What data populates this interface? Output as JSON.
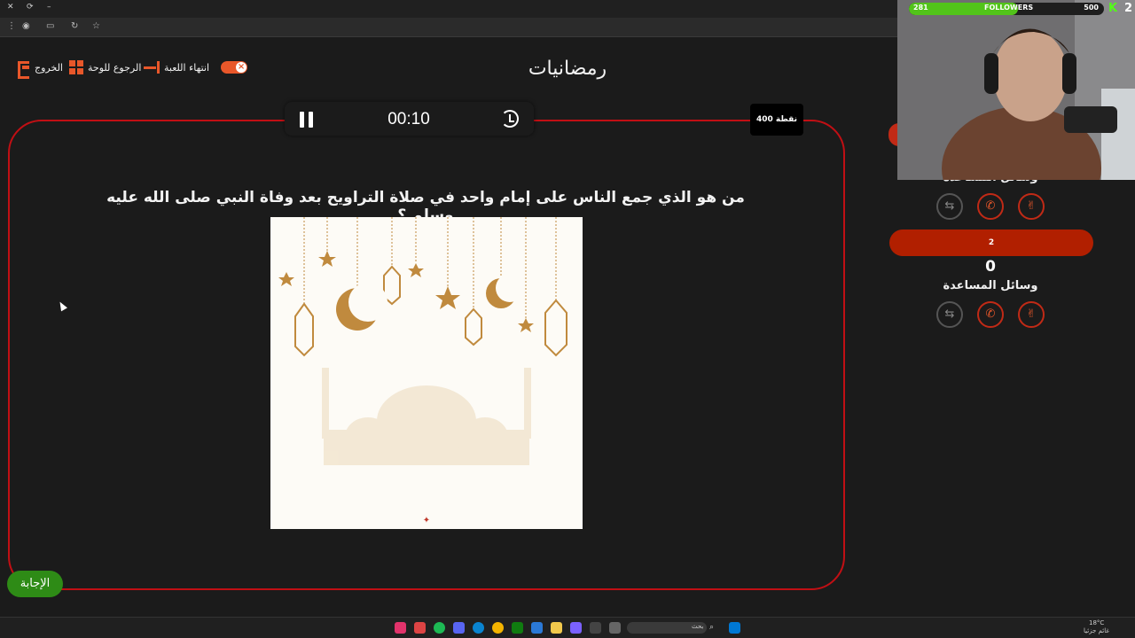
{
  "browser": {
    "window_controls": [
      "✕",
      "⟳",
      "–"
    ]
  },
  "game": {
    "title": "رمضانيات",
    "nav": {
      "exit_label": "الخروج",
      "back_label": "الرجوع للوحة",
      "end_label": "انتهاء اللعبة"
    },
    "timer": "00:10",
    "points": "400 نقطة",
    "question": "من هو الذي جمع الناس على إمام واحد في صلاة التراويح بعد وفاة النبي صلى الله عليه وسلم ؟",
    "answer_button": "الإجابة"
  },
  "teams": [
    {
      "label": "وسائل المساعدة"
    },
    {
      "name": "2",
      "score": "0",
      "label": "وسائل المساعدة"
    }
  ],
  "overlay": {
    "followers_current": "281",
    "followers_label": "FOLLOWERS",
    "followers_goal": "500",
    "followers_progress": 0.56,
    "kick_count": "2"
  },
  "taskbar": {
    "search_placeholder": "بحث",
    "weather": "18°C",
    "weather_sub": "غائم جزئيا"
  },
  "colors": {
    "accent": "#e8572a",
    "frame": "#c10f14",
    "answer": "#2e8b16",
    "team_pill": "#b11f00"
  }
}
